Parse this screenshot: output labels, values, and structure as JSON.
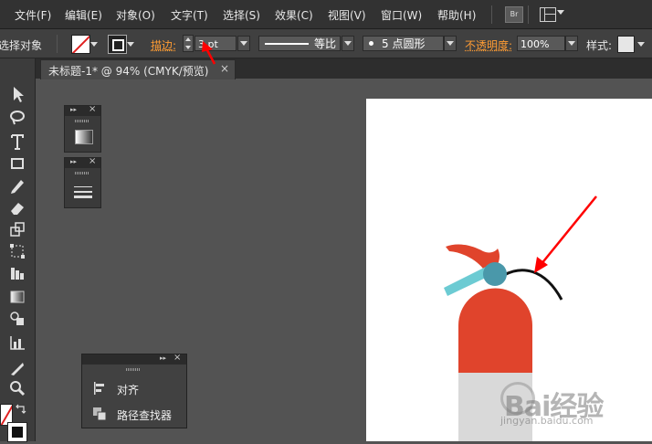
{
  "menu": {
    "items": [
      "文件(F)",
      "编辑(E)",
      "对象(O)",
      "文字(T)",
      "选择(S)",
      "效果(C)",
      "视图(V)",
      "窗口(W)",
      "帮助(H)"
    ],
    "bridge_label": "Br"
  },
  "control_bar": {
    "selection_label": "选择对象",
    "stroke_label": "描边:",
    "stroke_weight": "3 pt",
    "profile_label": "等比",
    "brush_label": "5 点圆形",
    "opacity_label": "不透明度:",
    "opacity_value": "100%",
    "style_label": "样式:"
  },
  "document": {
    "tab_title": "未标题-1* @ 94% (CMYK/预览)",
    "tab_close": "×"
  },
  "panels": {
    "align": {
      "label": "对齐"
    },
    "pathfinder": {
      "label": "路径查找器"
    }
  },
  "watermark": {
    "brand": "Bai经验",
    "url": "jingyan.baidu.com"
  },
  "colors": {
    "menubar_bg": "#323232",
    "controlbar_bg": "#404040",
    "workspace_bg": "#535353",
    "label_accent": "#ff9c33",
    "annotation_arrow": "#ff0000",
    "extinguisher_body": "#e0442c",
    "extinguisher_base": "#d9d9d9",
    "valve": "#4a98aa",
    "nozzle": "#6ccbd3"
  }
}
